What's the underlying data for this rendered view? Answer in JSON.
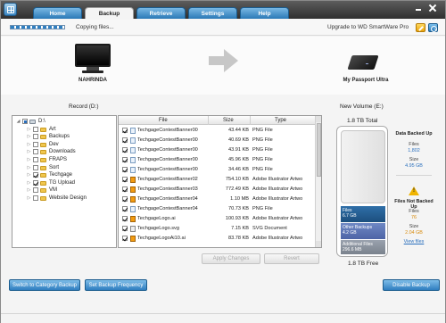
{
  "tabs": [
    "Home",
    "Backup",
    "Retrieve",
    "Settings",
    "Help"
  ],
  "status": {
    "text": "Copying files...",
    "upgrade": "Upgrade to WD SmartWare Pro"
  },
  "source": {
    "name": "NAHRINDA"
  },
  "destination": {
    "name": "My Passport Ultra"
  },
  "labels": {
    "record": "Record (D:)",
    "volume": "New Volume (E:)",
    "total": "1.8 TB Total",
    "free": "1.8 TB Free"
  },
  "tree": [
    {
      "label": "D:\\",
      "level": 0,
      "expander": "◢",
      "check": "partial",
      "icon": "drive"
    },
    {
      "label": "Art",
      "level": 1,
      "expander": "▷",
      "check": "none",
      "icon": "folder"
    },
    {
      "label": "Backups",
      "level": 1,
      "expander": "▷",
      "check": "none",
      "icon": "folder"
    },
    {
      "label": "Dev",
      "level": 1,
      "expander": "▷",
      "check": "none",
      "icon": "folder"
    },
    {
      "label": "Downloads",
      "level": 1,
      "expander": "▷",
      "check": "none",
      "icon": "folder"
    },
    {
      "label": "FRAPS",
      "level": 1,
      "expander": "▷",
      "check": "none",
      "icon": "folder"
    },
    {
      "label": "Sort",
      "level": 1,
      "expander": "▷",
      "check": "none",
      "icon": "folder"
    },
    {
      "label": "Techgage",
      "level": 1,
      "expander": "▷",
      "check": "checked",
      "icon": "folder"
    },
    {
      "label": "TG Upload",
      "level": 1,
      "expander": "▷",
      "check": "checked",
      "icon": "folder"
    },
    {
      "label": "VM",
      "level": 1,
      "expander": "▷",
      "check": "none",
      "icon": "folder"
    },
    {
      "label": "Website Design",
      "level": 1,
      "expander": "▷",
      "check": "none",
      "icon": "folder"
    }
  ],
  "file_columns": [
    "File",
    "Size",
    "Type"
  ],
  "files": [
    {
      "name": "TechgageContestBanner00",
      "size": "43.44 KB",
      "type": "PNG File",
      "icon": "png"
    },
    {
      "name": "TechgageContestBanner00",
      "size": "40.69 KB",
      "type": "PNG File",
      "icon": "png"
    },
    {
      "name": "TechgageContestBanner00",
      "size": "43.91 KB",
      "type": "PNG File",
      "icon": "png"
    },
    {
      "name": "TechgageContestBanner00",
      "size": "45.96 KB",
      "type": "PNG File",
      "icon": "png"
    },
    {
      "name": "TechgageContestBanner00",
      "size": "34.46 KB",
      "type": "PNG File",
      "icon": "png"
    },
    {
      "name": "TechgageContestBanner02",
      "size": "754.10 KB",
      "type": "Adobe Illustrator Artwo",
      "icon": "ai"
    },
    {
      "name": "TechgageContestBanner03",
      "size": "772.49 KB",
      "type": "Adobe Illustrator Artwo",
      "icon": "ai"
    },
    {
      "name": "TechgageContestBanner04",
      "size": "1.10 MB",
      "type": "Adobe Illustrator Artwo",
      "icon": "ai"
    },
    {
      "name": "TechgageContestBanner04",
      "size": "70.73 KB",
      "type": "PNG File",
      "icon": "png"
    },
    {
      "name": "TechgageLogo.ai",
      "size": "100.93 KB",
      "type": "Adobe Illustrator Artwo",
      "icon": "ai"
    },
    {
      "name": "TechgageLogo.svg",
      "size": "7.15 KB",
      "type": "SVG Document",
      "icon": "svg"
    },
    {
      "name": "TechgageLogoAi10.ai",
      "size": "83.78 KB",
      "type": "Adobe Illustrator Artwo",
      "icon": "ai"
    }
  ],
  "buttons": {
    "apply": "Apply Changes",
    "revert": "Revert",
    "switch": "Switch to Category Backup",
    "frequency": "Set Backup Frequency",
    "disable": "Disable Backup"
  },
  "capacity": {
    "files_label": "Files",
    "files_size": "6.7 GB",
    "other_label": "Other Backups",
    "other_size": "4.2 GB",
    "additional_label": "Additional Files",
    "additional_size": "296.6 MB"
  },
  "stats": {
    "backed_up_title": "Data Backed Up",
    "backed_files_label": "Files",
    "backed_files_value": "1,802",
    "backed_size_label": "Size",
    "backed_size_value": "4.95 GB",
    "not_backed_title": "Files Not Backed Up",
    "not_files_label": "Files",
    "not_files_value": "76",
    "not_size_label": "Size",
    "not_size_value": "2.04 GB",
    "view_files": "View files"
  },
  "colors": {
    "accent": "#2f7ec0",
    "tab_active_bg": "#f4f4f4",
    "warning": "#f0b400"
  }
}
